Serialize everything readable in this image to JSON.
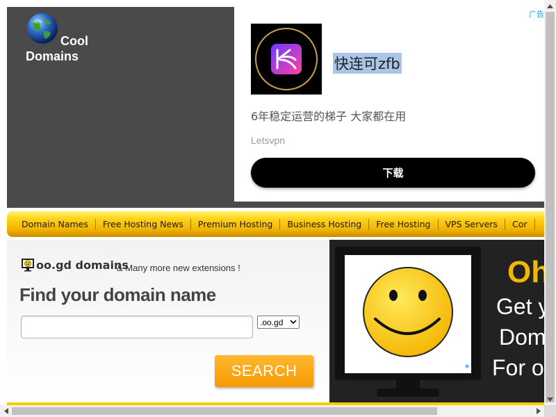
{
  "logo": {
    "line1": "Cool",
    "line2": "Domains",
    "icon": "globe-icon"
  },
  "ad": {
    "label": "广告",
    "title": "快连可zfb",
    "subtitle": "6年稳定运营的梯子 大家都在用",
    "brand": "Letsvpn",
    "download_label": "下载",
    "icon": "letsvpn-app-icon"
  },
  "nav": {
    "items": [
      {
        "label": "Domain Names"
      },
      {
        "label": "Free Hosting News"
      },
      {
        "label": "Premium Hosting"
      },
      {
        "label": "Business Hosting"
      },
      {
        "label": "Free Hosting"
      },
      {
        "label": "VPS Servers"
      },
      {
        "label": "Cor"
      }
    ]
  },
  "search": {
    "extension_domain": "oo.gd domains",
    "extension_more": "& Many more new extensions !",
    "find_title": "Find your domain name",
    "input_value": "",
    "tld_selected": ".oo.gd",
    "button_label": "SEARCH"
  },
  "promo": {
    "headline": "Oh",
    "line1": "Get y",
    "line2": "Dom",
    "line3": "For o",
    "icon": "smiley-monitor-icon"
  },
  "colors": {
    "header_bg": "#4a4a4a",
    "nav_gold": "#f3b400",
    "search_orange": "#f59a00",
    "promo_yellow": "#f2b705"
  }
}
